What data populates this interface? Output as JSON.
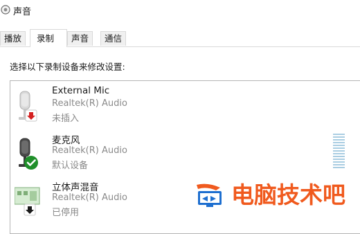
{
  "window": {
    "title": "声音",
    "title_icon": "speaker-icon"
  },
  "tabs": [
    {
      "label": "播放",
      "active": false
    },
    {
      "label": "录制",
      "active": true
    },
    {
      "label": "声音",
      "active": false
    },
    {
      "label": "通信",
      "active": false
    }
  ],
  "instruction": "选择以下录制设备来修改设置:",
  "devices": [
    {
      "name": "External Mic",
      "driver": "Realtek(R) Audio",
      "status": "未插入",
      "icon": "microphone-icon",
      "badge": "red-down-arrow-icon"
    },
    {
      "name": "麦克风",
      "driver": "Realtek(R) Audio",
      "status": "默认设备",
      "icon": "microphone-icon",
      "badge": "green-check-icon"
    },
    {
      "name": "立体声混音",
      "driver": "Realtek(R) Audio",
      "status": "已停用",
      "icon": "sound-card-icon",
      "badge": "black-down-arrow-icon"
    }
  ],
  "watermark": {
    "text": "电脑技术吧",
    "color": "#f05a1e",
    "accent": "#1e6fd0"
  },
  "colors": {
    "badge_red": "#d42020",
    "badge_green": "#1f8f2a",
    "level_meter": "#a9cde2"
  }
}
